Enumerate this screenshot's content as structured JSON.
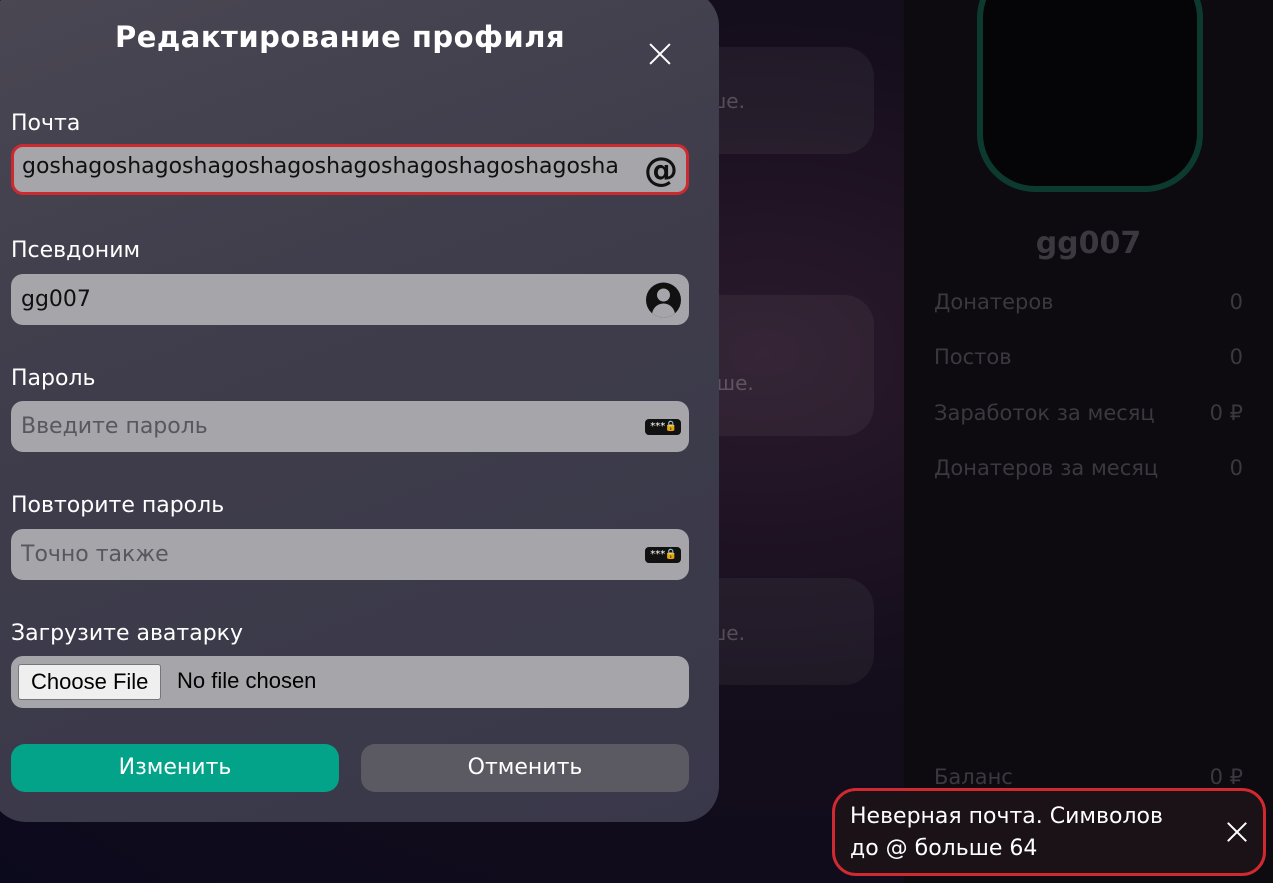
{
  "background": {
    "cards": [
      {
        "text": "ше."
      },
      {
        "text": "ьше."
      },
      {
        "text": "ше."
      }
    ],
    "profile": {
      "name": "gg007",
      "stats": [
        {
          "label": "Донатеров",
          "value": "0"
        },
        {
          "label": "Постов",
          "value": "0"
        },
        {
          "label": "Заработок за месяц",
          "value": "0 ₽"
        },
        {
          "label": "Донатеров за месяц",
          "value": "0"
        }
      ],
      "balance": {
        "label": "Баланс",
        "value": "0 ₽"
      }
    }
  },
  "modal": {
    "title": "Редактирование профиля",
    "fields": {
      "email": {
        "label": "Почта",
        "value": "goshagoshagoshagoshagoshagoshagoshagoshagosha",
        "icon": "at-icon"
      },
      "nickname": {
        "label": "Псевдоним",
        "value": "gg007",
        "icon": "user-icon"
      },
      "password": {
        "label": "Пароль",
        "placeholder": "Введите пароль",
        "icon": "password-icon",
        "icon_text": "***🔒"
      },
      "password_repeat": {
        "label": "Повторите пароль",
        "placeholder": "Точно также",
        "icon": "password-icon",
        "icon_text": "***🔒"
      },
      "avatar": {
        "label": "Загрузите аватарку",
        "button": "Choose File",
        "status": "No file chosen"
      }
    },
    "submit_label": "Изменить",
    "cancel_label": "Отменить"
  },
  "toast": {
    "message": "Неверная почта. Символов до @ больше 64"
  },
  "colors": {
    "accent": "#02a389",
    "error": "#cc2a2f"
  }
}
